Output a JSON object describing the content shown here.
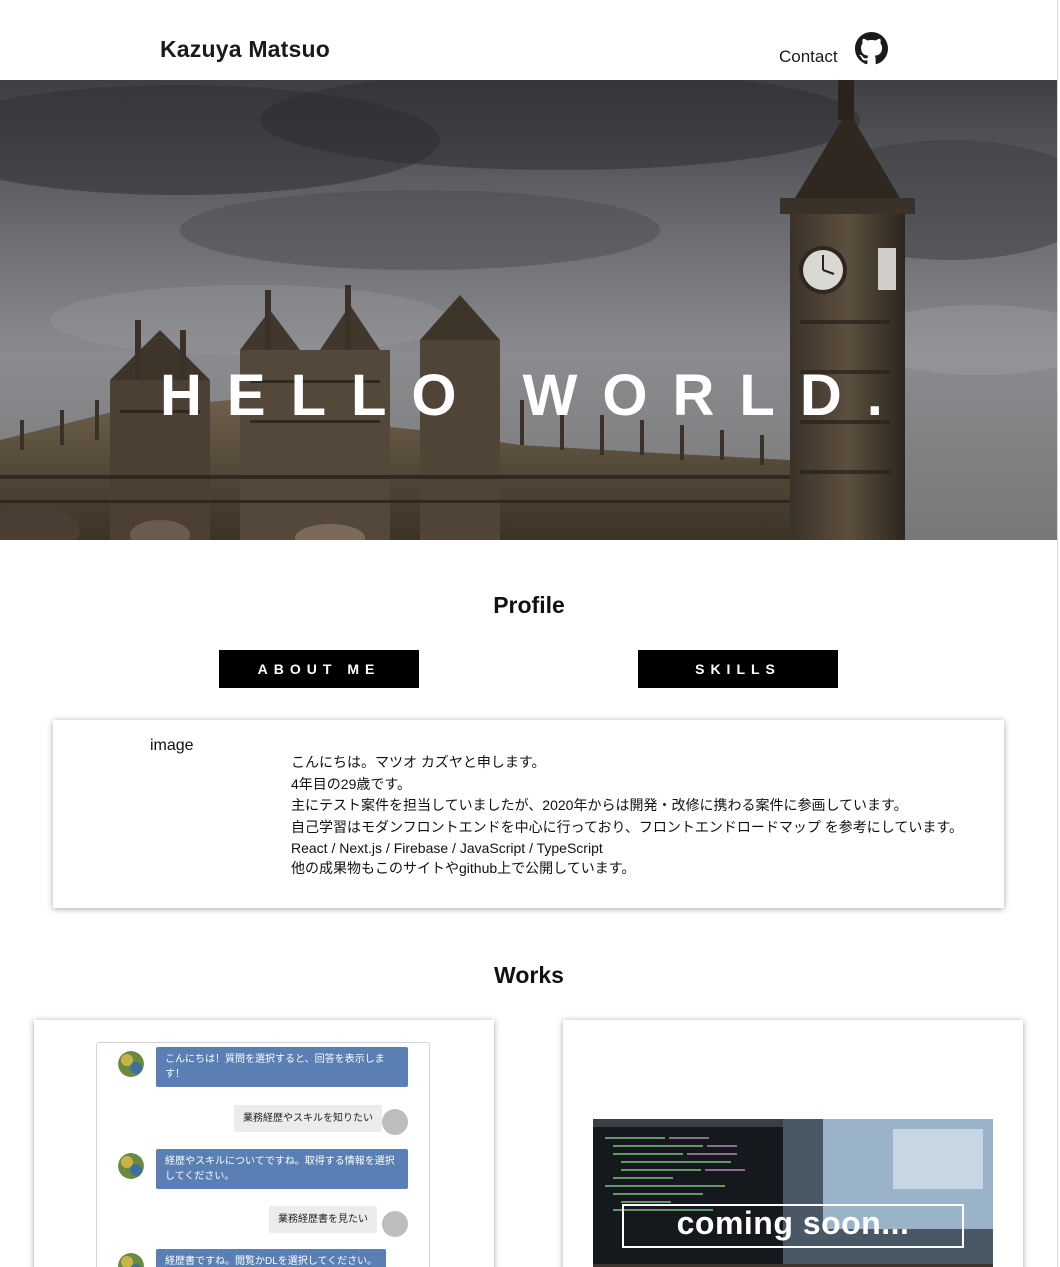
{
  "header": {
    "brand": "Kazuya Matsuo",
    "nav_contact": "Contact",
    "github_icon": "github-icon"
  },
  "hero": {
    "title": "HELLO WORLD."
  },
  "profile": {
    "title": "Profile",
    "tabs": [
      {
        "label": "ABOUT ME"
      },
      {
        "label": "SKILLS"
      }
    ],
    "image_placeholder": "image",
    "lines": [
      "こんにちは。マツオ カズヤと申します。",
      "4年目の29歳です。",
      "主にテスト案件を担当していましたが、2020年からは開発・改修に携わる案件に参画しています。",
      "自己学習はモダンフロントエンドを中心に行っており、フロントエンドロードマップ を参考にしています。",
      "React / Next.js / Firebase / JavaScript / TypeScript",
      "他の成果物もこのサイトやgithub上で公開しています。"
    ]
  },
  "works": {
    "title": "Works",
    "chat": {
      "messages": [
        {
          "from": "bot",
          "text": "こんにちは！質問を選択すると、回答を表示します！"
        },
        {
          "from": "user",
          "text": "業務経歴やスキルを知りたい"
        },
        {
          "from": "bot",
          "text": "経歴やスキルについてですね。取得する情報を選択してください。"
        },
        {
          "from": "user",
          "text": "業務経歴書を見たい"
        },
        {
          "from": "bot",
          "text": "経歴書ですね。閲覧かDLを選択してください。"
        }
      ]
    },
    "coming_soon": "coming soon..."
  },
  "colors": {
    "tab_bg": "#000000",
    "bot_bubble": "#5a7fb5",
    "user_bubble": "#ececec"
  }
}
